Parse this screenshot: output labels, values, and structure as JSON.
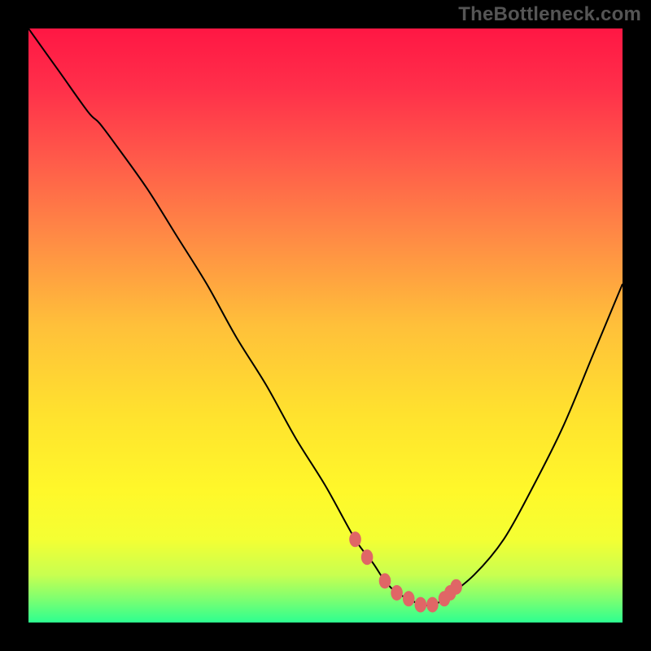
{
  "watermark": "TheBottleneck.com",
  "chart_data": {
    "type": "line",
    "title": "",
    "xlabel": "",
    "ylabel": "",
    "xlim": [
      0,
      100
    ],
    "ylim": [
      0,
      100
    ],
    "series": [
      {
        "name": "bottleneck-curve",
        "x": [
          0,
          5,
          10,
          12,
          15,
          20,
          25,
          30,
          35,
          40,
          45,
          50,
          55,
          58,
          60,
          62,
          64,
          66,
          68,
          70,
          75,
          80,
          85,
          90,
          95,
          100
        ],
        "y": [
          100,
          93,
          86,
          84,
          80,
          73,
          65,
          57,
          48,
          40,
          31,
          23,
          14,
          10,
          7,
          5,
          4,
          3,
          3,
          4,
          8,
          14,
          23,
          33,
          45,
          57
        ],
        "color": "#000000"
      }
    ],
    "highlight_dots": {
      "name": "optimal-range",
      "color": "#e06666",
      "points": [
        {
          "x": 55,
          "y": 14
        },
        {
          "x": 57,
          "y": 11
        },
        {
          "x": 60,
          "y": 7
        },
        {
          "x": 62,
          "y": 5
        },
        {
          "x": 64,
          "y": 4
        },
        {
          "x": 66,
          "y": 3
        },
        {
          "x": 68,
          "y": 3
        },
        {
          "x": 70,
          "y": 4
        },
        {
          "x": 71,
          "y": 5
        },
        {
          "x": 72,
          "y": 6
        }
      ]
    },
    "gradient_stops": [
      {
        "offset": 0.0,
        "color": "#ff1744"
      },
      {
        "offset": 0.1,
        "color": "#ff2f4a"
      },
      {
        "offset": 0.22,
        "color": "#ff5a4a"
      },
      {
        "offset": 0.35,
        "color": "#ff8a45"
      },
      {
        "offset": 0.5,
        "color": "#ffc03a"
      },
      {
        "offset": 0.65,
        "color": "#ffe22e"
      },
      {
        "offset": 0.78,
        "color": "#fff82a"
      },
      {
        "offset": 0.86,
        "color": "#f4ff33"
      },
      {
        "offset": 0.92,
        "color": "#c8ff50"
      },
      {
        "offset": 0.96,
        "color": "#7eff70"
      },
      {
        "offset": 1.0,
        "color": "#2dff90"
      }
    ]
  }
}
